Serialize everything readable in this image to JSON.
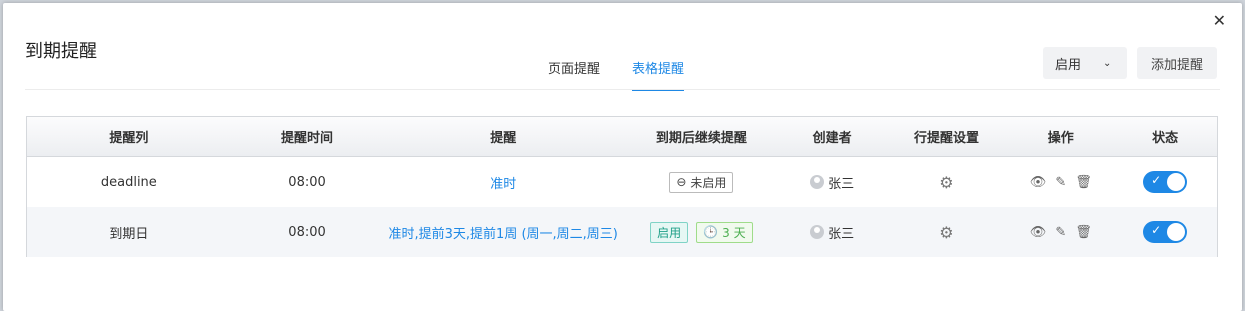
{
  "dialog": {
    "title": "到期提醒",
    "close_icon": "close-icon"
  },
  "tabs": [
    {
      "label": "页面提醒",
      "active": false
    },
    {
      "label": "表格提醒",
      "active": true
    }
  ],
  "toolbar": {
    "enable_label": "启用",
    "add_label": "添加提醒"
  },
  "table": {
    "headers": [
      "提醒列",
      "提醒时间",
      "提醒",
      "到期后继续提醒",
      "创建者",
      "行提醒设置",
      "操作",
      "状态"
    ],
    "rows": [
      {
        "column": "deadline",
        "time": "08:00",
        "reminder": "准时",
        "continue_tag": "未启用",
        "creator": "张三",
        "status_on": true
      },
      {
        "column": "到期日",
        "time": "08:00",
        "reminder": "准时,提前3天,提前1周 (周一,周二,周三)",
        "continue_tag": "启用",
        "continue_days": "3 天",
        "creator": "张三",
        "status_on": true
      }
    ]
  },
  "colors": {
    "accent": "#1e88e5",
    "enabled_tag": "#20a089",
    "days_tag": "#4caf50"
  }
}
